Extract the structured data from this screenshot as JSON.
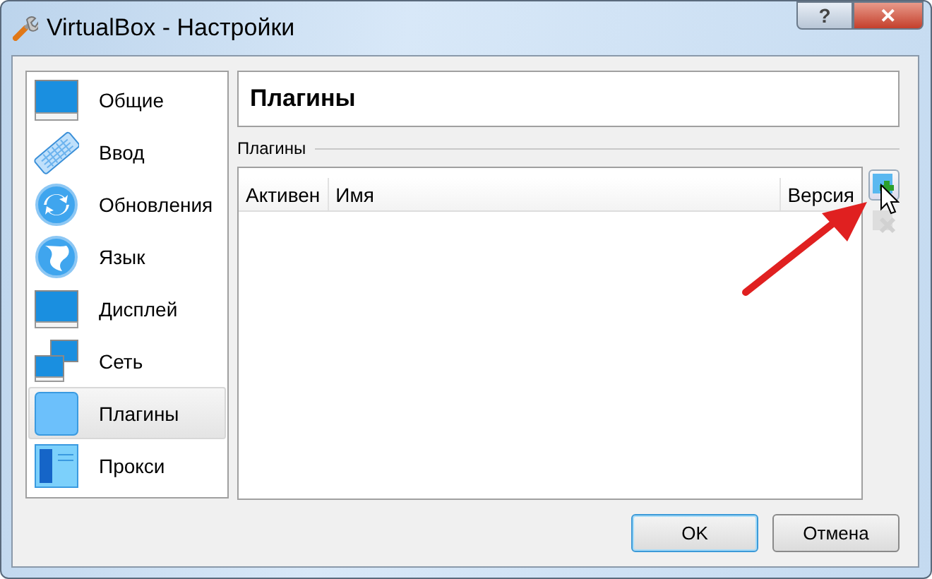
{
  "window": {
    "title": "VirtualBox - Настройки",
    "buttons": [
      {
        "kind": "help",
        "label": "?"
      },
      {
        "kind": "close",
        "label": "✕"
      }
    ]
  },
  "sidebar": {
    "items": [
      {
        "label": "Общие",
        "kind": "general",
        "selected": false
      },
      {
        "label": "Ввод",
        "kind": "input",
        "selected": false
      },
      {
        "label": "Обновления",
        "kind": "update",
        "selected": false
      },
      {
        "label": "Язык",
        "kind": "language",
        "selected": false
      },
      {
        "label": "Дисплей",
        "kind": "display",
        "selected": false
      },
      {
        "label": "Сеть",
        "kind": "network",
        "selected": false
      },
      {
        "label": "Плагины",
        "kind": "plugins",
        "selected": true
      },
      {
        "label": "Прокси",
        "kind": "proxy",
        "selected": false
      }
    ]
  },
  "page_title": "Плагины",
  "group_label": "Плагины",
  "table": {
    "columns": [
      "Активен",
      "Имя",
      "Версия"
    ]
  },
  "table_buttons": [
    {
      "kind": "add",
      "disabled": false
    },
    {
      "kind": "remove",
      "disabled": true
    }
  ],
  "annotation": {
    "kind": "arrow"
  },
  "dialog_buttons": [
    {
      "label": "OK",
      "default": true
    },
    {
      "label": "Отмена",
      "default": false
    }
  ]
}
